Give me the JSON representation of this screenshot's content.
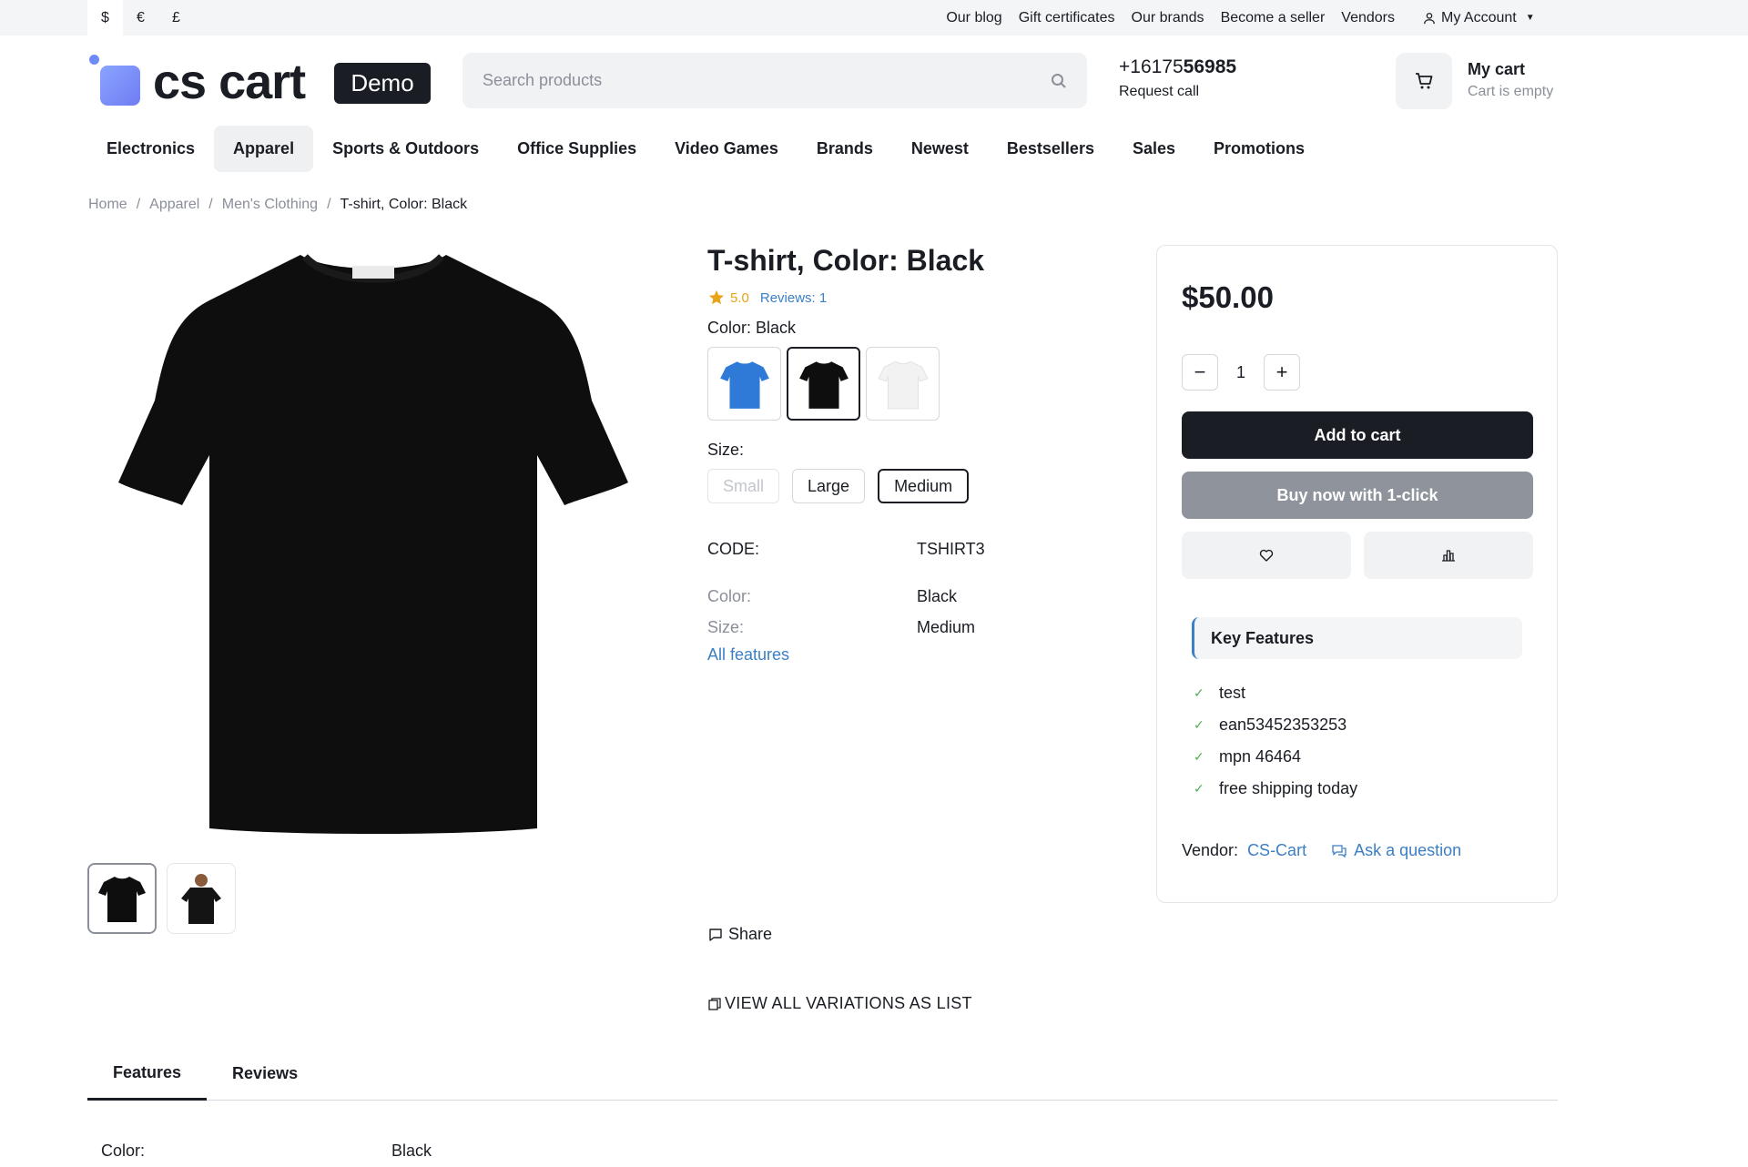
{
  "topbar": {
    "currencies": [
      "$",
      "€",
      "£"
    ],
    "links": [
      "Our blog",
      "Gift certificates",
      "Our brands",
      "Become a seller",
      "Vendors"
    ],
    "account_label": "My Account"
  },
  "header": {
    "logo_text": "cs cart",
    "badge": "Demo",
    "search_placeholder": "Search products",
    "phone_prefix": "+16175",
    "phone_bold": "56985",
    "request_call": "Request call",
    "cart_title": "My cart",
    "cart_status": "Cart is empty"
  },
  "nav": {
    "items": [
      "Electronics",
      "Apparel",
      "Sports & Outdoors",
      "Office Supplies",
      "Video Games",
      "Brands",
      "Newest",
      "Bestsellers",
      "Sales",
      "Promotions"
    ],
    "active_index": 1
  },
  "breadcrumb": [
    "Home",
    "Apparel",
    "Men's Clothing",
    "T-shirt, Color: Black"
  ],
  "product": {
    "title": "T-shirt, Color: Black",
    "rating": "5.0",
    "reviews": "Reviews: 1",
    "color_label": "Color:",
    "color_value": "Black",
    "colors": [
      "blue",
      "black",
      "white"
    ],
    "size_label": "Size:",
    "sizes": [
      "Small",
      "Large",
      "Medium"
    ],
    "code_label": "CODE:",
    "code_value": "TSHIRT3",
    "features": [
      {
        "name": "Color:",
        "value": "Black"
      },
      {
        "name": "Size:",
        "value": "Medium"
      }
    ],
    "all_features": "All features",
    "share": "Share",
    "variations": "VIEW ALL VARIATIONS AS LIST"
  },
  "buybox": {
    "price": "$50.00",
    "quantity": "1",
    "add_to_cart": "Add to cart",
    "one_click": "Buy now with 1-click",
    "key_features_title": "Key Features",
    "key_features": [
      "test",
      "ean53452353253",
      "mpn 46464",
      "free shipping today"
    ],
    "vendor_label": "Vendor:",
    "vendor_name": "CS-Cart",
    "ask_question": "Ask a question"
  },
  "tabs": {
    "items": [
      "Features",
      "Reviews"
    ],
    "active_index": 0,
    "row": {
      "name": "Color:",
      "value": "Black"
    }
  },
  "colors": {
    "accent_link": "#3b7fc4",
    "primary_dark": "#1a1d24",
    "star": "#e8a317",
    "check": "#4caf50"
  }
}
